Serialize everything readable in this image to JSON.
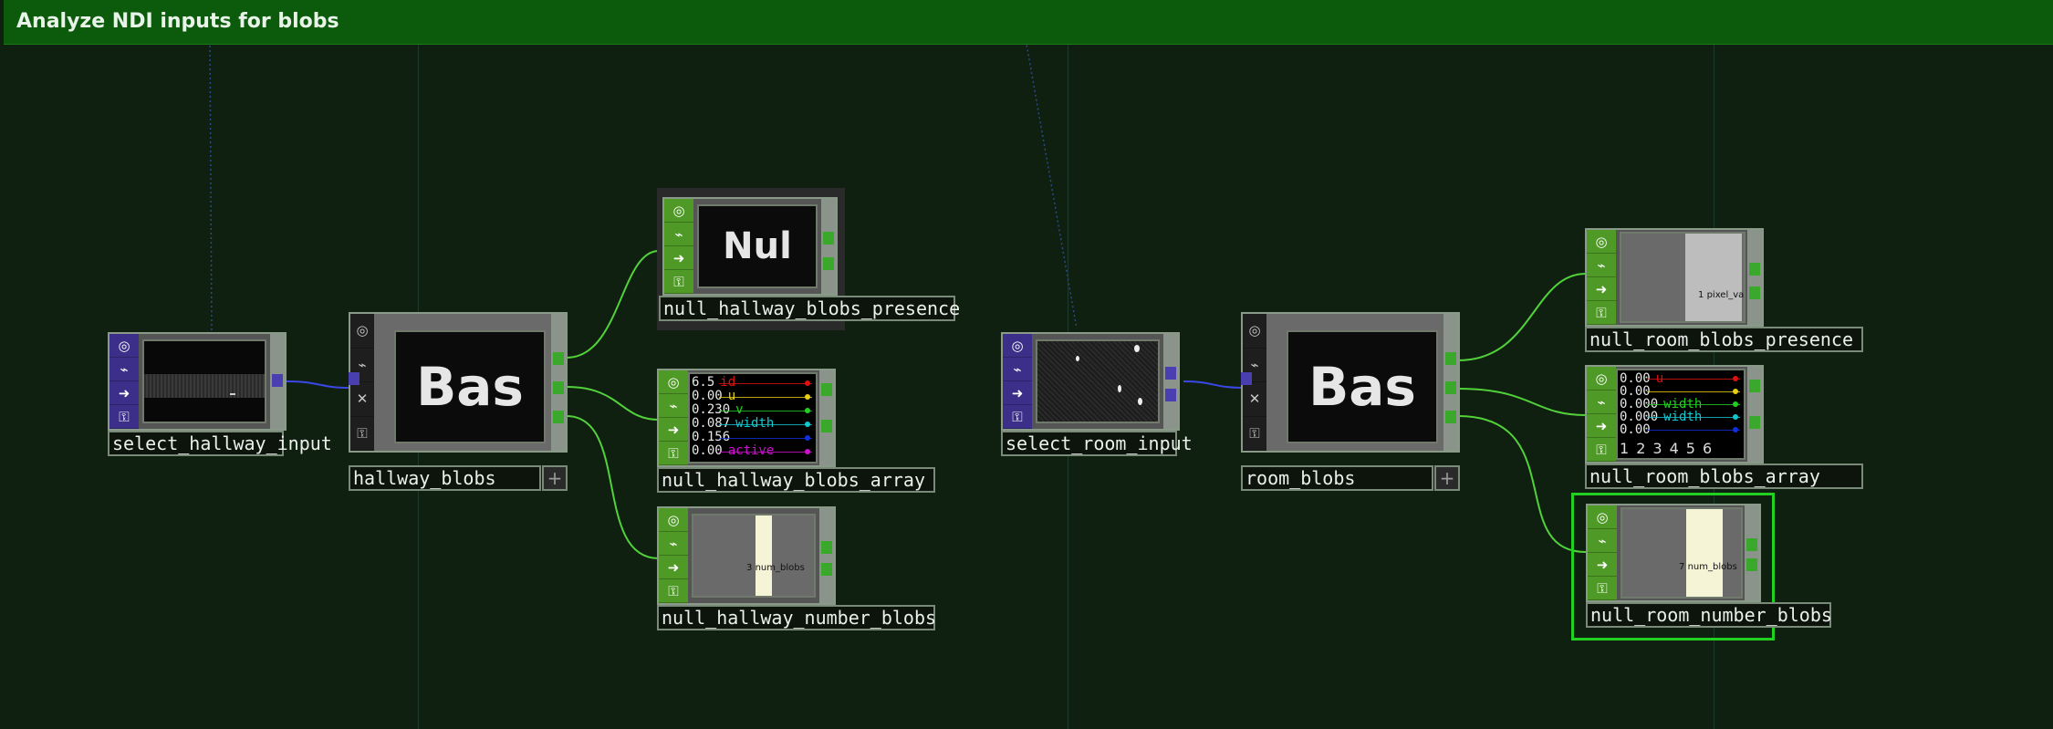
{
  "network": {
    "title": "Analyze NDI inputs for blobs"
  },
  "nodes": {
    "select_hallway_input": {
      "name": "select_hallway_input"
    },
    "hallway_blobs": {
      "name": "hallway_blobs",
      "viewer_text": "Bas"
    },
    "null_hallway_blobs_presence": {
      "name": "null_hallway_blobs_presence",
      "viewer_text": "Nul"
    },
    "null_hallway_blobs_array": {
      "name": "null_hallway_blobs_array",
      "rows": [
        {
          "value": "6.5",
          "label": "id",
          "color": "#e01010"
        },
        {
          "value": "0.00",
          "label": "u",
          "color": "#e8d010"
        },
        {
          "value": "0.230",
          "label": "v",
          "color": "#20d020"
        },
        {
          "value": "0.087",
          "label": "width",
          "color": "#10c8d0"
        },
        {
          "value": "0.156",
          "label": "",
          "color": "#1030e0"
        },
        {
          "value": "0.00",
          "label": "active",
          "color": "#d010d0"
        }
      ]
    },
    "null_hallway_number_blobs": {
      "name": "null_hallway_number_blobs",
      "value": "3",
      "channel": "num_blobs"
    },
    "select_room_input": {
      "name": "select_room_input"
    },
    "room_blobs": {
      "name": "room_blobs",
      "viewer_text": "Bas"
    },
    "null_room_blobs_presence": {
      "name": "null_room_blobs_presence",
      "value": "1",
      "channel": "pixel_value_"
    },
    "null_room_blobs_array": {
      "name": "null_room_blobs_array",
      "rows": [
        {
          "value": "0.00",
          "label": "u",
          "color": "#e01010"
        },
        {
          "value": "0.00",
          "label": "",
          "color": "#e8d010"
        },
        {
          "value": "0.000",
          "label": "width",
          "color": "#20d020"
        },
        {
          "value": "0.000",
          "label": "width",
          "color": "#10c8d0"
        },
        {
          "value": "0.00",
          "label": "",
          "color": "#1030e0"
        }
      ],
      "columns": [
        "1",
        "2",
        "3",
        "4",
        "5",
        "6"
      ]
    },
    "null_room_number_blobs": {
      "name": "null_room_number_blobs",
      "value": "7",
      "channel": "num_blobs"
    }
  },
  "icons": {
    "flag_icons": [
      "circle-icon",
      "wave-icon",
      "arrow-right-icon",
      "lock-icon"
    ],
    "bypass_icon": "close-icon",
    "plus_icon": "plus-icon"
  },
  "colors": {
    "background": "#102010",
    "banner": "#0c5a0c",
    "wire_green": "#52d23a",
    "wire_blue": "#3a48e8",
    "flag_green": "#4f9a26",
    "flag_purple": "#3c2f8a",
    "selection": "#22d022"
  },
  "glyphs": {
    "circle": "◎",
    "wave": "⌁",
    "arrow": "➜",
    "lock": "⚿",
    "close": "✕",
    "plus": "+"
  }
}
